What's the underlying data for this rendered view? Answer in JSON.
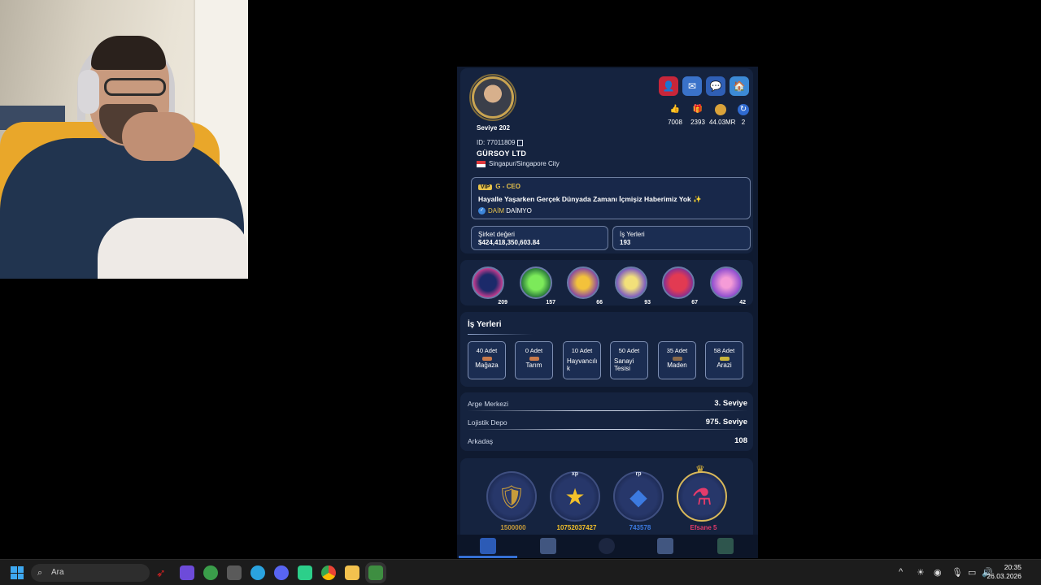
{
  "webcam": {
    "label": "streamer webcam"
  },
  "profile": {
    "level": "Seviye 202",
    "id_label": "ID: 77011809",
    "company": "GÜRSOY LTD",
    "location": "Singapur/Singapore City",
    "stats": [
      {
        "icon": "thumbs-up-icon",
        "value": "7008"
      },
      {
        "icon": "gift-icon",
        "value": "2393"
      },
      {
        "icon": "coin-icon",
        "value": "44.03MR"
      },
      {
        "icon": "refresh-icon",
        "value": "2"
      }
    ],
    "vip_tag": "VIP",
    "vip_title": "G - CEO",
    "motto": "Hayalle Yaşarken Gerçek Dünyada Zamanı İçmişiz Haberimiz Yok ✨",
    "daim_gold": "DAİM",
    "daim_text": "DAİMYO",
    "company_value_label": "Şirket değeri",
    "company_value": "$424,418,350,603.84",
    "workplaces_label": "İş Yerleri",
    "workplaces_count": "193"
  },
  "inventory": [
    "209",
    "157",
    "66",
    "93",
    "67",
    "42"
  ],
  "workplaces": {
    "title": "İş Yerleri",
    "items": [
      {
        "count": "40 Adet",
        "label": "Mağaza"
      },
      {
        "count": "0 Adet",
        "label": "Tarım"
      },
      {
        "count": "10 Adet",
        "label": "Hayvancılı k"
      },
      {
        "count": "50 Adet",
        "label": "Sanayi Tesisi"
      },
      {
        "count": "35 Adet",
        "label": "Maden"
      },
      {
        "count": "58 Adet",
        "label": "Arazi"
      }
    ]
  },
  "facilities": [
    {
      "label": "Arge Merkezi",
      "value": "3. Seviye"
    },
    {
      "label": "Lojistik Depo",
      "value": "975. Seviye"
    },
    {
      "label": "Arkadaş",
      "value": "108"
    }
  ],
  "medals": [
    {
      "tag": "",
      "value": "1500000"
    },
    {
      "tag": "xp",
      "value": "10752037427"
    },
    {
      "tag": "rp",
      "value": "743578"
    },
    {
      "tag": "",
      "value": "Efsane 5"
    }
  ],
  "taskbar": {
    "search_placeholder": "Ara",
    "time": "20:35",
    "date": "26.03.2026"
  },
  "colors": {
    "accent": "#3570d4",
    "gold": "#e8c34a",
    "danger": "#c7263a"
  }
}
